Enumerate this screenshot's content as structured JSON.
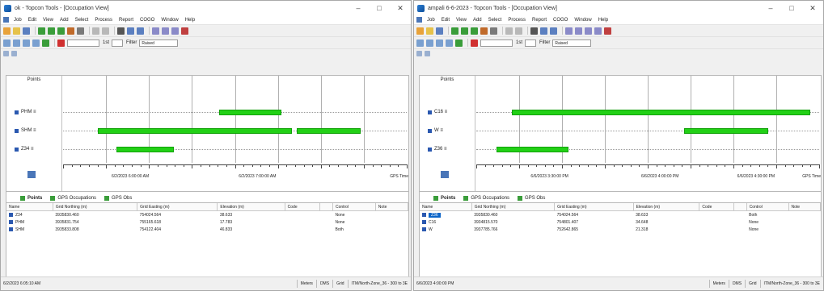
{
  "left": {
    "title": "ok - Topcon Tools - [Occupation View]",
    "menu": [
      "Job",
      "Edit",
      "View",
      "Add",
      "Select",
      "Process",
      "Report",
      "COGO",
      "Window",
      "Help"
    ],
    "points_title": "Points",
    "rows": [
      "PHM",
      "SHM",
      "Z34"
    ],
    "bars": [
      {
        "row": 0,
        "start": 0.453,
        "end": 0.635
      },
      {
        "row": 1,
        "start": 0.102,
        "end": 0.667
      },
      {
        "row": 1,
        "start": 0.679,
        "end": 0.867
      },
      {
        "row": 2,
        "start": 0.155,
        "end": 0.322
      }
    ],
    "ticks": [
      "6/2/2023 6:00:00 AM",
      "6/2/2023 7:00:00 AM"
    ],
    "tick_pos": [
      0.2,
      0.57
    ],
    "gps_time": "GPS Time",
    "tabs": [
      "Points",
      "GPS Occupations",
      "GPS Obs"
    ],
    "columns": [
      "Name",
      "Grid Northing (m)",
      "Grid Easting (m)",
      "Elevation (m)",
      "Code",
      "",
      "Control",
      "Note"
    ],
    "table": [
      {
        "name": "Z34",
        "n": "3935830.460",
        "e": "754024.564",
        "el": "38.633",
        "code": "",
        "control": "None"
      },
      {
        "name": "PHM",
        "n": "3935831.754",
        "e": "755165.618",
        "el": "17.783",
        "code": "",
        "control": "None"
      },
      {
        "name": "SHM",
        "n": "3935833.808",
        "e": "754122.404",
        "el": "46.833",
        "code": "",
        "control": "Both"
      }
    ],
    "status_left": "6/2/2023 6:05:10 AM",
    "status_cells": [
      "Meters",
      "DMS",
      "Grid",
      "ITM/North-Zone_36 - 300 to 3E"
    ],
    "toolbar": {
      "slider_label": "1st",
      "filter_label": "Filter",
      "filter_value": "Raised"
    }
  },
  "right": {
    "title": "ampali 6-6-2023 - Topcon Tools - [Occupation View]",
    "menu": [
      "Job",
      "Edit",
      "View",
      "Add",
      "Select",
      "Process",
      "Report",
      "COGO",
      "Window",
      "Help"
    ],
    "points_title": "Points",
    "rows": [
      "C16",
      "W",
      "Z36"
    ],
    "bars": [
      {
        "row": 0,
        "start": 0.103,
        "end": 0.973
      },
      {
        "row": 1,
        "start": 0.606,
        "end": 0.851
      },
      {
        "row": 2,
        "start": 0.06,
        "end": 0.268
      }
    ],
    "ticks": [
      "6/6/2023 3:30:00 PM",
      "6/6/2023 4:00:00 PM",
      "6/6/2023 4:30:00 PM"
    ],
    "tick_pos": [
      0.218,
      0.54,
      0.82
    ],
    "gps_time": "GPS Time",
    "tabs": [
      "Points",
      "GPS Occupations",
      "GPS Obs"
    ],
    "columns": [
      "Name",
      "Grid Northing (m)",
      "Grid Easting (m)",
      "Elevation (m)",
      "Code",
      "",
      "Control",
      "Note"
    ],
    "table": [
      {
        "name": "Z36",
        "n": "3935830.460",
        "e": "754024.564",
        "el": "38.633",
        "code": "",
        "control": "Both"
      },
      {
        "name": "C16",
        "n": "3934815.570",
        "e": "754801.407",
        "el": "34.648",
        "code": "",
        "control": "None"
      },
      {
        "name": "W",
        "n": "3937785.766",
        "e": "752642.865",
        "el": "21.318",
        "code": "",
        "control": "None"
      }
    ],
    "status_left": "6/6/2023 4:00:00 PM",
    "status_cells": [
      "Meters",
      "DMS",
      "Grid",
      "ITM/North-Zone_36 - 300 to 3E"
    ],
    "toolbar": {
      "slider_label": "1st",
      "filter_label": "Filter",
      "filter_value": "Raised"
    }
  },
  "colors": {
    "bar": "#22d016",
    "bar_border": "#12a00a",
    "point_marker": "#2a58b0",
    "selection": "#0a64c8"
  }
}
